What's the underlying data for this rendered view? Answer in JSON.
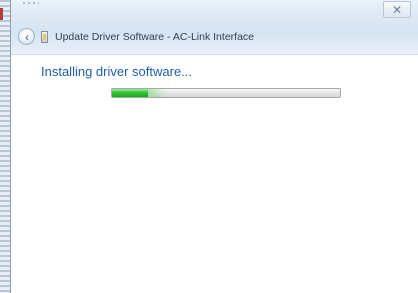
{
  "window": {
    "title": "Update Driver Software - AC-Link Interface",
    "close_label": "✕"
  },
  "content": {
    "heading": "Installing driver software..."
  },
  "progress": {
    "value": 0.16
  },
  "icons": {
    "back": "back-arrow-icon",
    "device": "device-driver-icon",
    "close": "close-icon"
  }
}
